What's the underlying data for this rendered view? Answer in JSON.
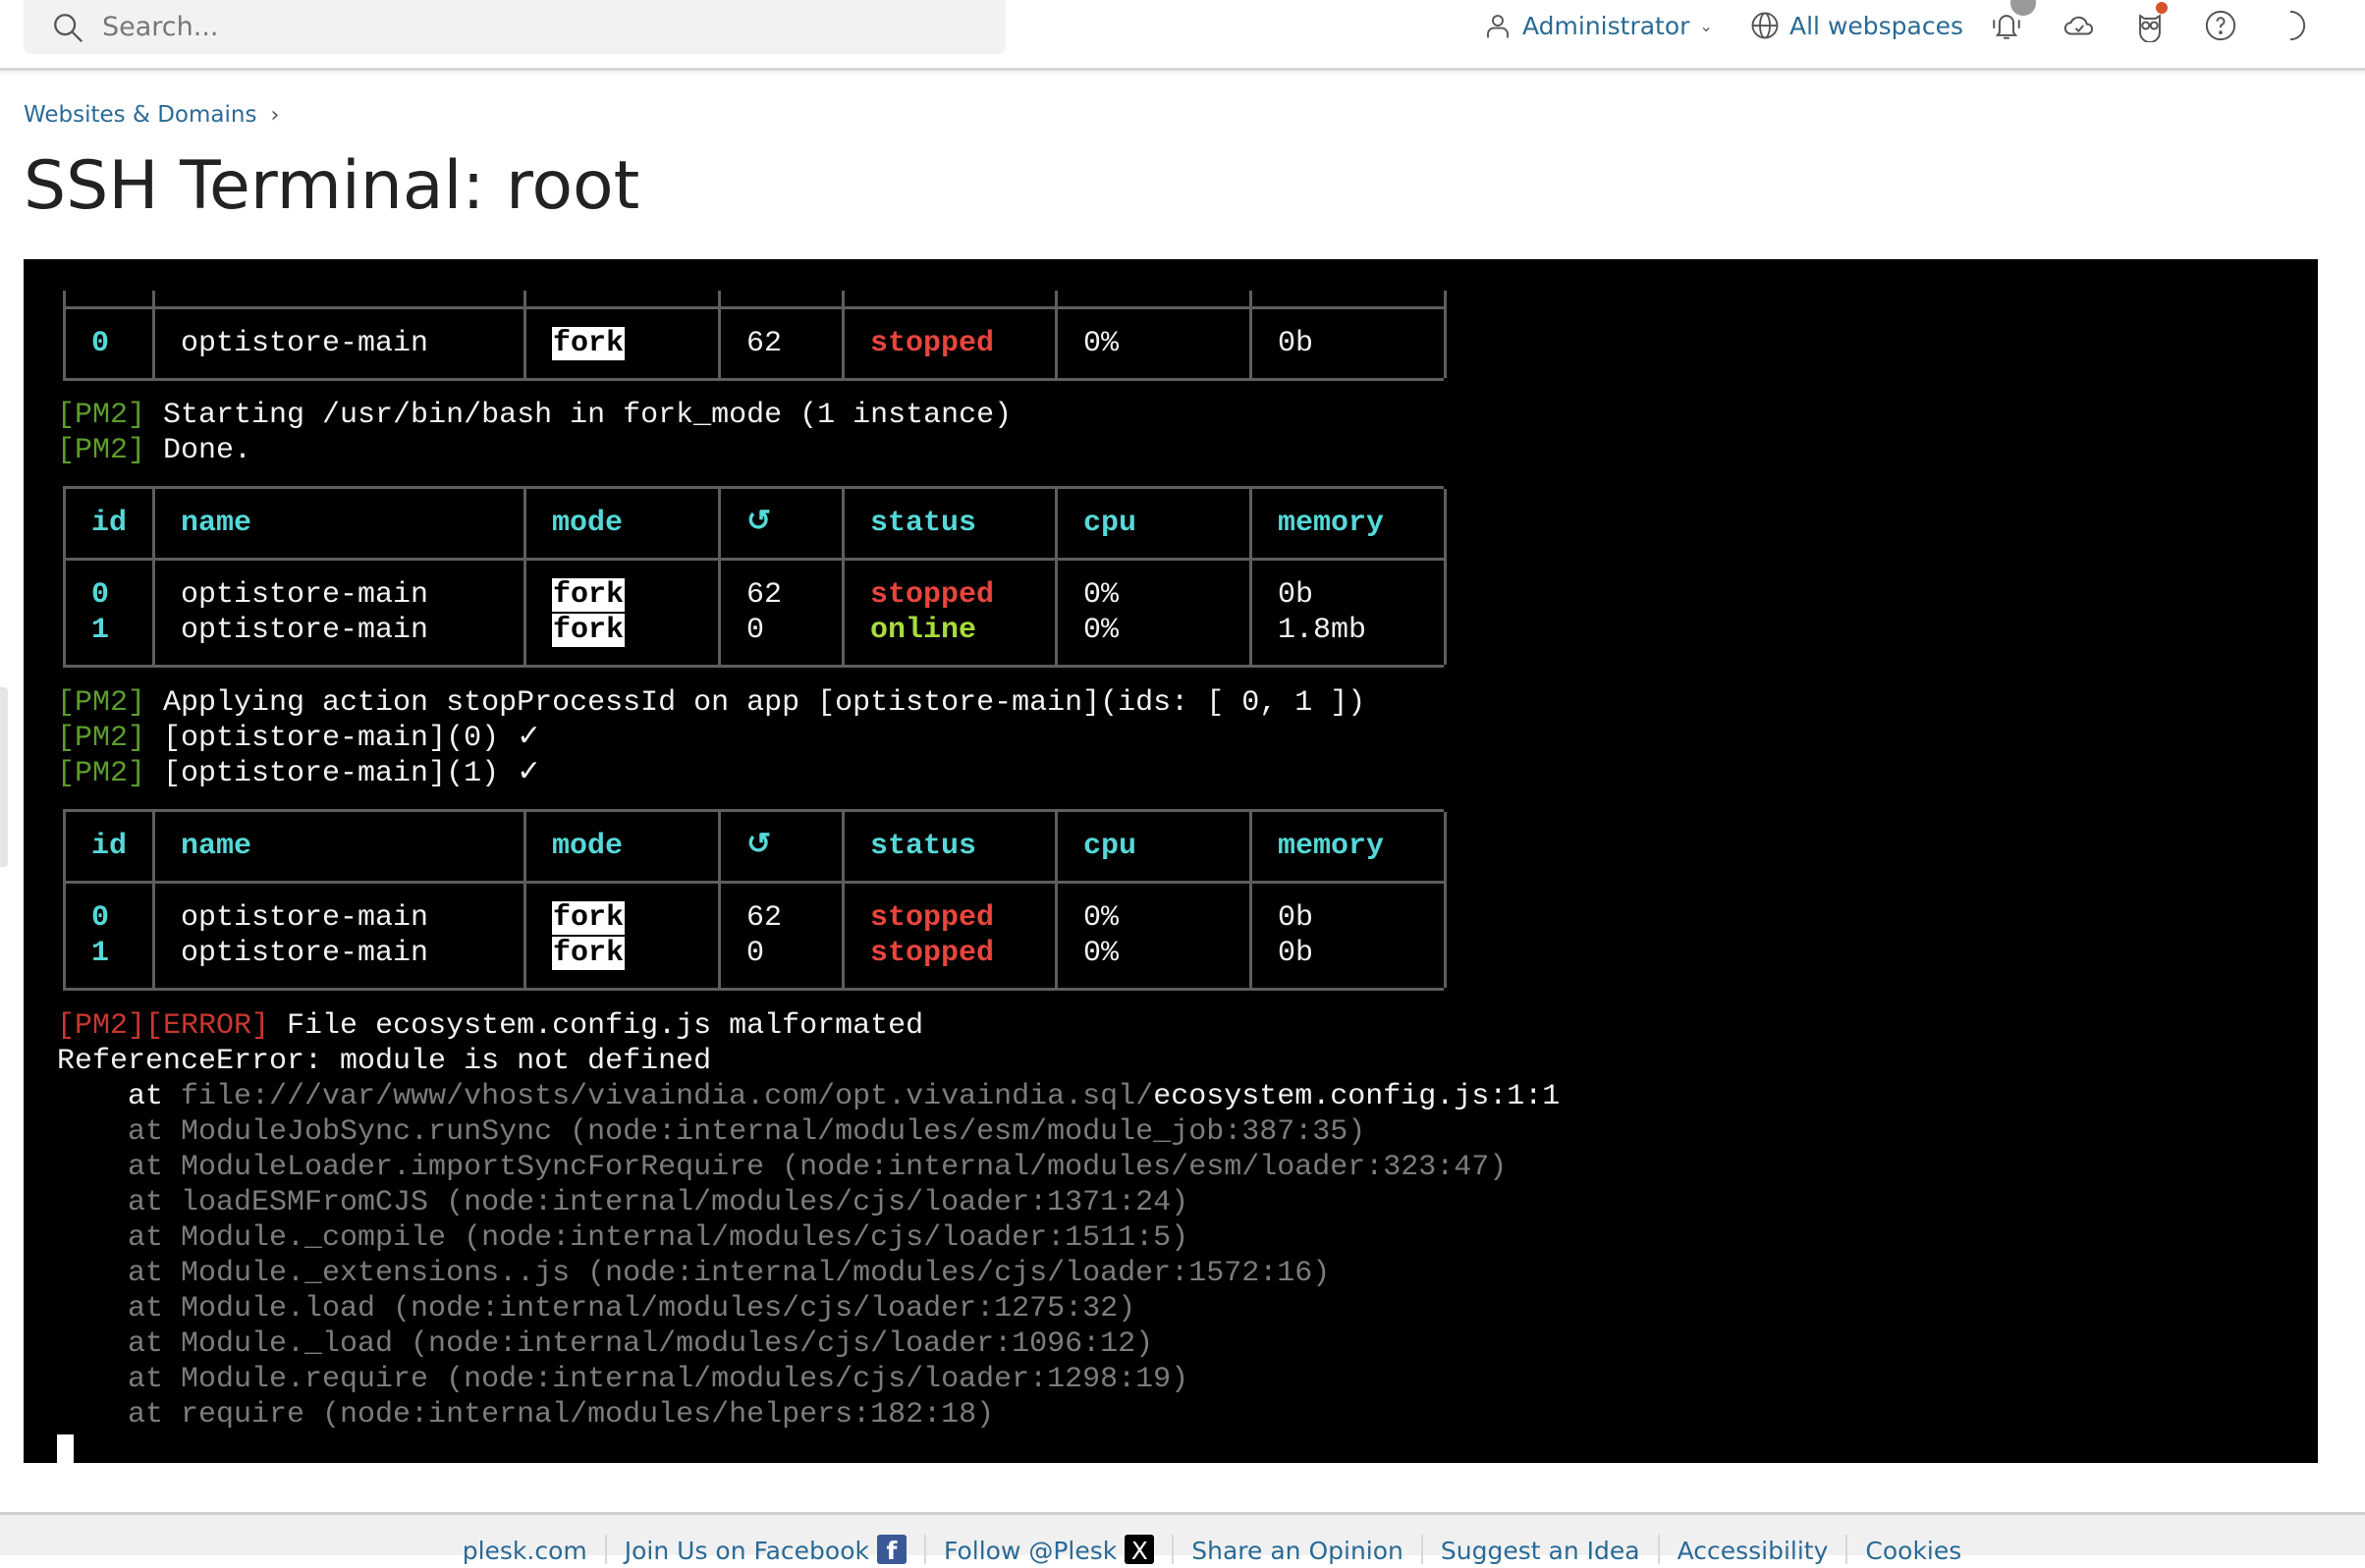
{
  "header": {
    "search_placeholder": "Search...",
    "user_label": "Administrator",
    "webspaces_label": "All webspaces",
    "icons": [
      "notifications-bell-icon",
      "cloud-check-icon",
      "owl-advisor-icon",
      "help-icon",
      "dark-mode-moon-icon"
    ]
  },
  "breadcrumb": {
    "item": "Websites & Domains"
  },
  "page_title": "SSH Terminal: root",
  "terminal": {
    "blocks": [
      {
        "type": "table",
        "header": false,
        "rows": [
          [
            "0",
            "optistore-main",
            "fork",
            "62",
            "stopped",
            "0%",
            "0b"
          ]
        ]
      },
      {
        "type": "line",
        "segments": [
          {
            "t": "[PM2]",
            "c": "pm2"
          },
          {
            "t": " Starting /usr/bin/bash in fork_mode (1 instance)",
            "c": "white"
          }
        ]
      },
      {
        "type": "line",
        "segments": [
          {
            "t": "[PM2]",
            "c": "pm2"
          },
          {
            "t": " Done.",
            "c": "white"
          }
        ]
      },
      {
        "type": "table",
        "header": true,
        "columns": [
          "id",
          "name",
          "mode",
          "↺",
          "status",
          "cpu",
          "memory"
        ],
        "rows": [
          [
            "0",
            "optistore-main",
            "fork",
            "62",
            "stopped",
            "0%",
            "0b"
          ],
          [
            "1",
            "optistore-main",
            "fork",
            "0",
            "online",
            "0%",
            "1.8mb"
          ]
        ]
      },
      {
        "type": "line",
        "segments": [
          {
            "t": "[PM2]",
            "c": "pm2"
          },
          {
            "t": " Applying action stopProcessId on app [optistore-main](ids: [ 0, 1 ])",
            "c": "white"
          }
        ]
      },
      {
        "type": "line",
        "segments": [
          {
            "t": "[PM2]",
            "c": "pm2"
          },
          {
            "t": " [optistore-main](0) ✓",
            "c": "white"
          }
        ]
      },
      {
        "type": "line",
        "segments": [
          {
            "t": "[PM2]",
            "c": "pm2"
          },
          {
            "t": " [optistore-main](1) ✓",
            "c": "white"
          }
        ]
      },
      {
        "type": "table",
        "header": true,
        "columns": [
          "id",
          "name",
          "mode",
          "↺",
          "status",
          "cpu",
          "memory"
        ],
        "rows": [
          [
            "0",
            "optistore-main",
            "fork",
            "62",
            "stopped",
            "0%",
            "0b"
          ],
          [
            "1",
            "optistore-main",
            "fork",
            "0",
            "stopped",
            "0%",
            "0b"
          ]
        ]
      },
      {
        "type": "line",
        "segments": [
          {
            "t": "[PM2][ERROR]",
            "c": "err"
          },
          {
            "t": " File ecosystem.config.js malformated",
            "c": "white"
          }
        ]
      },
      {
        "type": "line",
        "segments": [
          {
            "t": "ReferenceError: module is not defined",
            "c": "white"
          }
        ]
      },
      {
        "type": "line",
        "segments": [
          {
            "t": "    at ",
            "c": "white"
          },
          {
            "t": "file:///var/www/vhosts/vivaindia.com/opt.vivaindia.sql/",
            "c": "gray"
          },
          {
            "t": "ecosystem.config.js:1:1",
            "c": "white"
          }
        ]
      },
      {
        "type": "line",
        "segments": [
          {
            "t": "    at ModuleJobSync.runSync (node:internal/modules/esm/module_job:387:35)",
            "c": "gray"
          }
        ]
      },
      {
        "type": "line",
        "segments": [
          {
            "t": "    at ModuleLoader.importSyncForRequire (node:internal/modules/esm/loader:323:47)",
            "c": "gray"
          }
        ]
      },
      {
        "type": "line",
        "segments": [
          {
            "t": "    at loadESMFromCJS (node:internal/modules/cjs/loader:1371:24)",
            "c": "gray"
          }
        ]
      },
      {
        "type": "line",
        "segments": [
          {
            "t": "    at Module._compile (node:internal/modules/cjs/loader:1511:5)",
            "c": "gray"
          }
        ]
      },
      {
        "type": "line",
        "segments": [
          {
            "t": "    at Module._extensions..js (node:internal/modules/cjs/loader:1572:16)",
            "c": "gray"
          }
        ]
      },
      {
        "type": "line",
        "segments": [
          {
            "t": "    at Module.load (node:internal/modules/cjs/loader:1275:32)",
            "c": "gray"
          }
        ]
      },
      {
        "type": "line",
        "segments": [
          {
            "t": "    at Module._load (node:internal/modules/cjs/loader:1096:12)",
            "c": "gray"
          }
        ]
      },
      {
        "type": "line",
        "segments": [
          {
            "t": "    at Module.require (node:internal/modules/cjs/loader:1298:19)",
            "c": "gray"
          }
        ]
      },
      {
        "type": "line",
        "segments": [
          {
            "t": "    at require (node:internal/modules/helpers:182:18)",
            "c": "gray"
          }
        ]
      }
    ],
    "status_colors": {
      "stopped": "#e8453c",
      "online": "#a8dc3c"
    }
  },
  "footer": {
    "links": [
      "plesk.com",
      "Join Us on Facebook",
      "Follow @Plesk",
      "Share an Opinion",
      "Suggest an Idea",
      "Accessibility",
      "Cookies"
    ],
    "facebook_glyph": "f",
    "x_glyph": "X"
  }
}
